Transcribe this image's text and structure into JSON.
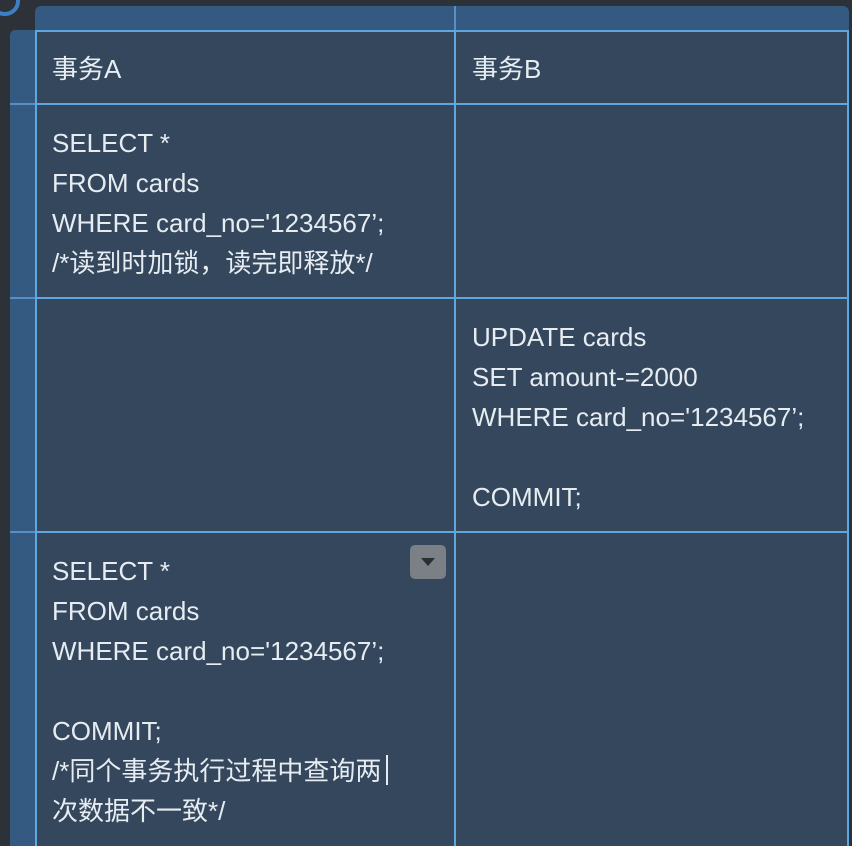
{
  "table": {
    "headers": [
      "事务A",
      "事务B"
    ],
    "rows": [
      {
        "a": "SELECT *\nFROM cards\nWHERE card_no='1234567’;\n/*读到时加锁，读完即释放*/",
        "b": ""
      },
      {
        "a": "",
        "b": "UPDATE cards\nSET amount-=2000\nWHERE card_no='1234567’;\n\nCOMMIT;"
      },
      {
        "a": "SELECT *\nFROM cards\nWHERE card_no='1234567’;\n\nCOMMIT;\n/*同个事务执行过程中查询两\n次数据不一致*/",
        "b": ""
      }
    ]
  },
  "colors": {
    "cell_background": "#34475c",
    "grid_lines": "#5fa7df",
    "header_bar": "#355a82",
    "text": "#e6ecf2"
  },
  "icons": {
    "cell_menu": "chevron-down-icon"
  }
}
